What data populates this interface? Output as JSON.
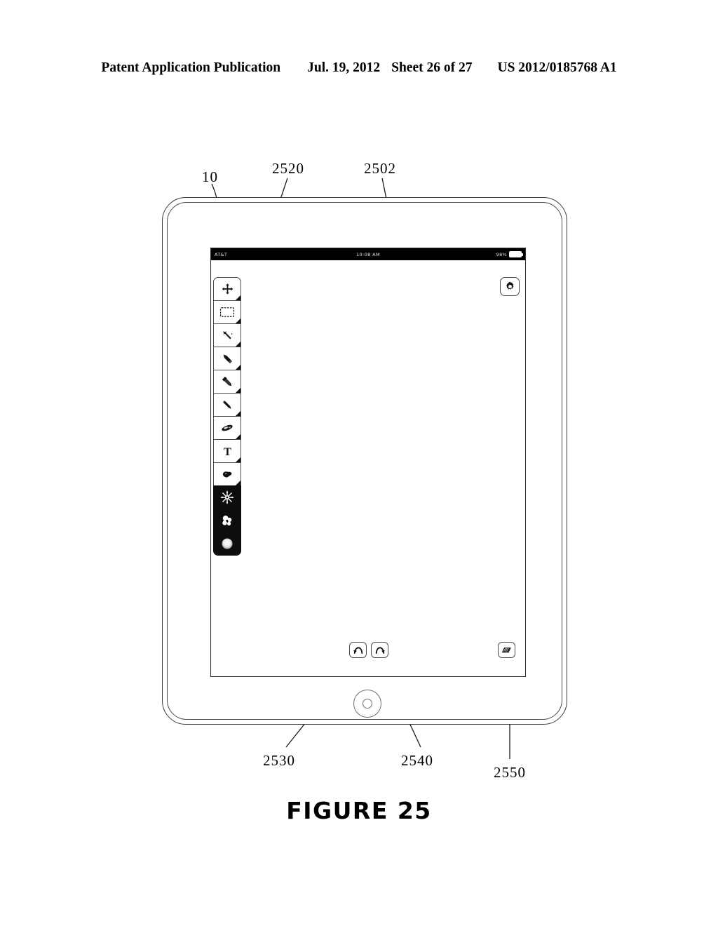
{
  "header": {
    "publication": "Patent Application Publication",
    "date": "Jul. 19, 2012",
    "sheet": "Sheet 26 of 27",
    "pub_number": "US 2012/0185768 A1"
  },
  "figure": {
    "caption": "FIGURE 25"
  },
  "reference_numerals": [
    {
      "id": "ref-10",
      "label": "10"
    },
    {
      "id": "ref-2520",
      "label": "2520"
    },
    {
      "id": "ref-2502",
      "label": "2502"
    },
    {
      "id": "ref-2530",
      "label": "2530"
    },
    {
      "id": "ref-2540",
      "label": "2540"
    },
    {
      "id": "ref-2550",
      "label": "2550"
    }
  ],
  "device": {
    "status_bar": {
      "carrier": "AT&T",
      "time": "10:08 AM",
      "battery_percent": "98%",
      "battery_icon": "battery-icon",
      "background_color": "#000000",
      "text_color": "#ffffff"
    },
    "settings_button": {
      "icon": "gear-icon",
      "label": "Settings"
    },
    "tool_palette": [
      {
        "icon": "move-icon",
        "label": "Move",
        "selected": false
      },
      {
        "icon": "marquee-icon",
        "label": "Rectangle Select",
        "selected": false
      },
      {
        "icon": "magic-wand-icon",
        "label": "Magic Wand",
        "selected": false
      },
      {
        "icon": "pen-icon",
        "label": "Pen",
        "selected": false
      },
      {
        "icon": "marker-icon",
        "label": "Marker",
        "selected": false
      },
      {
        "icon": "pencil-icon",
        "label": "Pencil",
        "selected": false
      },
      {
        "icon": "smudge-icon",
        "label": "Smudge",
        "selected": false
      },
      {
        "icon": "text-icon",
        "label": "Text",
        "selected": false
      },
      {
        "icon": "stamp-icon",
        "label": "Stamp",
        "selected": false
      },
      {
        "icon": "sparkle-icon",
        "label": "Sparkle Brush",
        "selected": true
      },
      {
        "icon": "petals-icon",
        "label": "Petal Brush",
        "selected": true
      },
      {
        "icon": "dot-circle-icon",
        "label": "Round Brush",
        "selected": true
      }
    ],
    "bottom_controls": [
      {
        "id": "undo-button",
        "icon": "undo-arrow-icon",
        "label": "Undo"
      },
      {
        "id": "redo-button",
        "icon": "redo-arrow-icon",
        "label": "Redo"
      },
      {
        "id": "layers-button",
        "icon": "layers-icon",
        "label": "Layers"
      }
    ],
    "home_button": {
      "icon": "home-button-icon",
      "label": "Home"
    }
  },
  "colors": {
    "line": "#2d2d2d",
    "status_bar": "#000000",
    "tool_selected_bg": "#0d0d0d",
    "page_bg": "#ffffff"
  }
}
